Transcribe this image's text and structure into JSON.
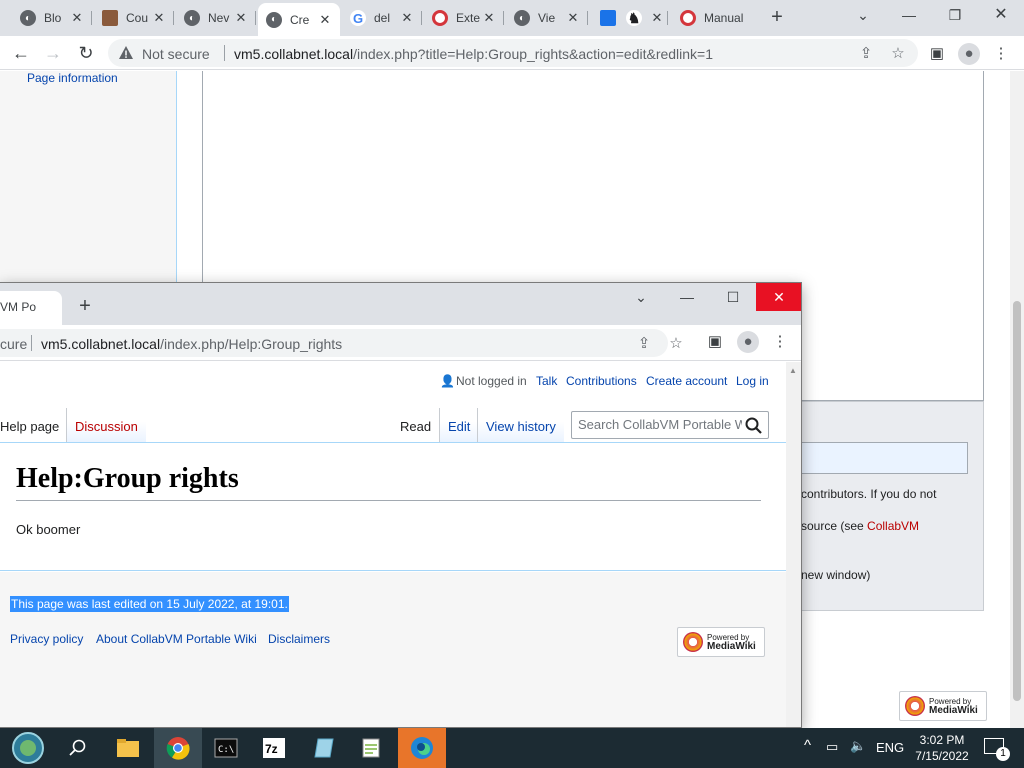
{
  "back_window": {
    "tabs": [
      {
        "title": "Blo",
        "favicon": "chrome-icon"
      },
      {
        "title": "Cou",
        "favicon": "avatar-icon"
      },
      {
        "title": "Nev",
        "favicon": "chrome-icon"
      },
      {
        "title": "Cre",
        "favicon": "chrome-icon",
        "active": true
      },
      {
        "title": "del",
        "favicon": "google-icon"
      },
      {
        "title": "Exte",
        "favicon": "opera-icon"
      },
      {
        "title": "Vie",
        "favicon": "chrome-icon"
      },
      {
        "title": "",
        "favicon": "puzzle-icon"
      },
      {
        "title": "",
        "favicon": "tool-icon"
      },
      {
        "title": "Manual",
        "favicon": "opera-icon"
      }
    ],
    "security_status": "Not secure",
    "url_host": "vm5.collabnet.local",
    "url_path": "/index.php?title=Help:Group_rights&action=edit&redlink=1",
    "sidebar_link": "Page information",
    "edit_notice_1": "contributors. If you do not",
    "edit_notice_2_prefix": "source (see ",
    "edit_notice_2_link": "CollabVM",
    "edit_notice_3": "new window)",
    "powered_by": "Powered by",
    "mediawiki": "MediaWiki"
  },
  "front_window": {
    "tab_title": "VM Po",
    "url_prefix": "cure",
    "url_host": "vm5.collabnet.local",
    "url_path": "/index.php/Help:Group_rights",
    "personal": {
      "not_logged_in": "Not logged in",
      "talk": "Talk",
      "contributions": "Contributions",
      "create_account": "Create account",
      "log_in": "Log in"
    },
    "tabs": {
      "help_page": "Help page",
      "discussion": "Discussion",
      "read": "Read",
      "edit": "Edit",
      "view_history": "View history"
    },
    "search_placeholder": "Search CollabVM Portable Wiki",
    "page_title": "Help:Group rights",
    "page_text": "Ok boomer",
    "last_edited": "This page was last edited on 15 July 2022, at 19:01.",
    "footer_links": {
      "privacy": "Privacy policy",
      "about": "About CollabVM Portable Wiki",
      "disclaimers": "Disclaimers"
    },
    "powered_by": "Powered by",
    "mediawiki": "MediaWiki"
  },
  "taskbar": {
    "language": "ENG",
    "time": "3:02 PM",
    "date": "7/15/2022",
    "notification_count": "1"
  },
  "colors": {
    "link": "#0645ad",
    "redlink": "#ba0000",
    "close_red": "#e81123",
    "selection": "#3390ff",
    "taskbar": "#1c2b33"
  }
}
